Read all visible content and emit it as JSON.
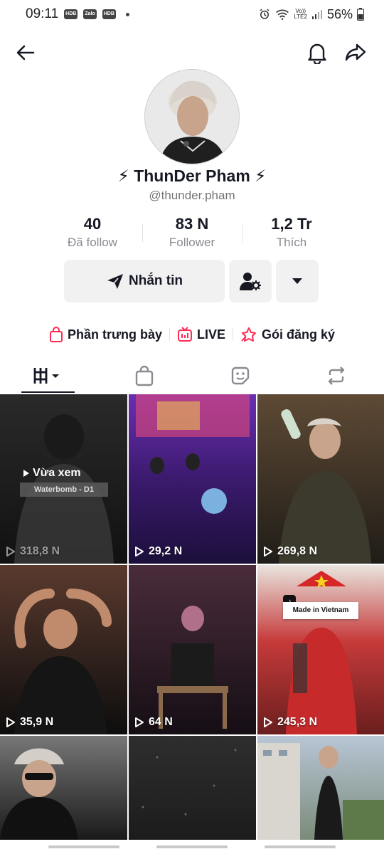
{
  "status_bar": {
    "time": "09:11",
    "battery": "56%",
    "lte_label_top": "Vo))",
    "lte_label_bottom": "LTE2",
    "mini_icons": [
      "HDB",
      "Zalo",
      "HDB"
    ]
  },
  "profile": {
    "display_name": "ThunDer Pham",
    "username": "@thunder.pham",
    "name_emoji": "⚡"
  },
  "stats": [
    {
      "value": "40",
      "label": "Đã follow"
    },
    {
      "value": "83 N",
      "label": "Follower"
    },
    {
      "value": "1,2 Tr",
      "label": "Thích"
    }
  ],
  "actions": {
    "message_label": "Nhắn tin"
  },
  "links": [
    {
      "label": "Phần trưng bày",
      "icon": "shopping-bag-icon"
    },
    {
      "label": "LIVE",
      "icon": "live-tv-icon"
    },
    {
      "label": "Gói đăng ký",
      "icon": "subscription-star-icon"
    }
  ],
  "tabs": [
    {
      "icon": "videos-grid-icon",
      "active": true
    },
    {
      "icon": "shop-bag-icon",
      "active": false
    },
    {
      "icon": "sticker-icon",
      "active": false
    },
    {
      "icon": "repost-icon",
      "active": false
    }
  ],
  "videos": [
    {
      "views": "318,8 N",
      "watched_label": "Vừa xem",
      "watched_sub": "Waterbomb - D1",
      "colors": [
        "#2a2a2a",
        "#111111"
      ]
    },
    {
      "views": "29,2 N",
      "colors": [
        "#6a2fb0",
        "#1b0f3a"
      ]
    },
    {
      "views": "269,8 N",
      "colors": [
        "#5e4a35",
        "#1f1c17"
      ]
    },
    {
      "views": "35,9 N",
      "colors": [
        "#5a3a2e",
        "#0d0d0d"
      ]
    },
    {
      "views": "64 N",
      "colors": [
        "#4a2c3a",
        "#150e14"
      ]
    },
    {
      "views": "245,3 N",
      "badge": "Made in Vietnam",
      "colors": [
        "#c63a3a",
        "#6a1e1e"
      ]
    },
    {
      "colors": [
        "#777777",
        "#1a1a1a"
      ]
    },
    {
      "colors": [
        "#2e2e2e",
        "#1c1c1c"
      ]
    },
    {
      "colors": [
        "#b8c6d6",
        "#7a8b7a"
      ]
    }
  ]
}
